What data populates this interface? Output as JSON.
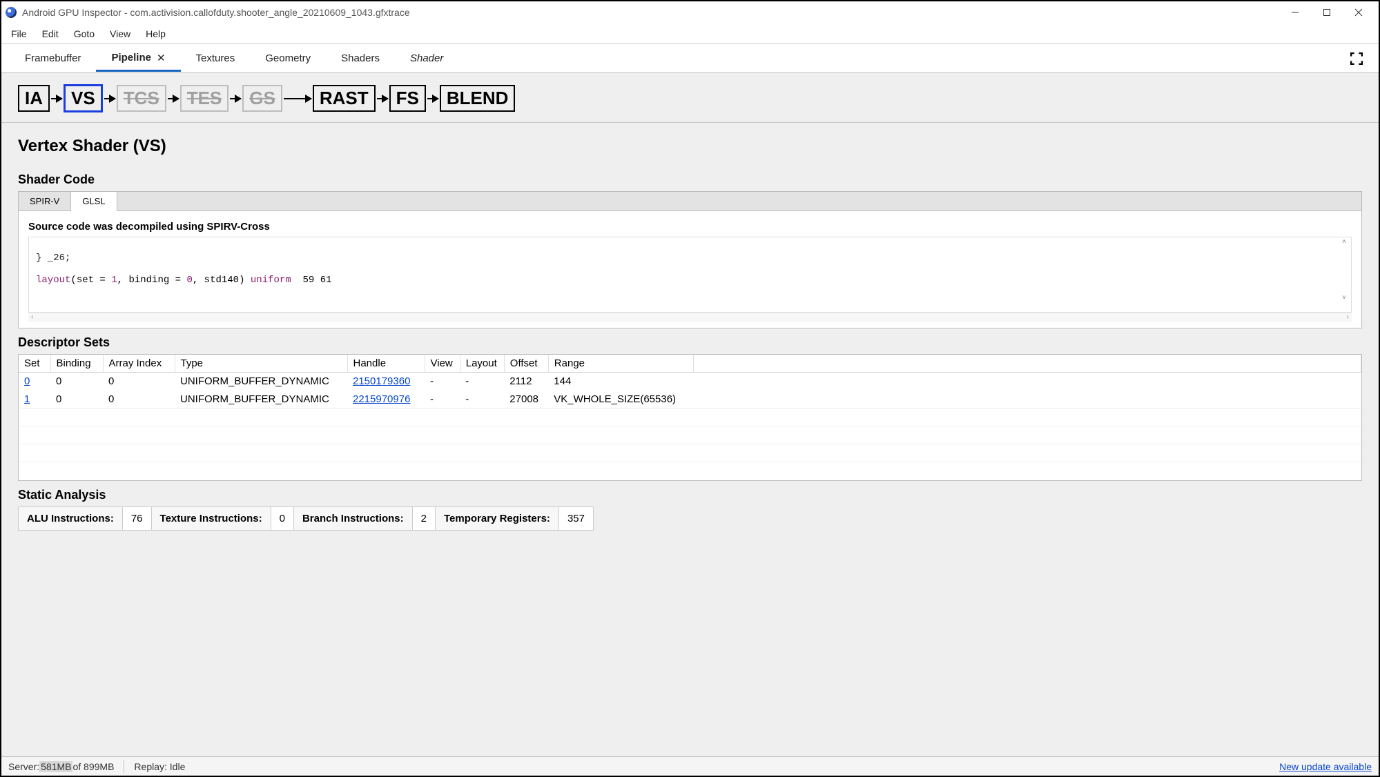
{
  "titlebar": {
    "title": "Android GPU Inspector - com.activision.callofduty.shooter_angle_20210609_1043.gfxtrace"
  },
  "menubar": {
    "items": [
      "File",
      "Edit",
      "Goto",
      "View",
      "Help"
    ]
  },
  "tabs": {
    "items": [
      {
        "label": "Framebuffer",
        "active": false
      },
      {
        "label": "Pipeline",
        "active": true,
        "closable": true
      },
      {
        "label": "Textures",
        "active": false
      },
      {
        "label": "Geometry",
        "active": false
      },
      {
        "label": "Shaders",
        "active": false
      },
      {
        "label": "Shader",
        "active": false,
        "italic": true
      }
    ]
  },
  "pipeline": {
    "stages": [
      {
        "label": "IA",
        "state": "normal"
      },
      {
        "label": "VS",
        "state": "selected"
      },
      {
        "label": "TCS",
        "state": "disabled"
      },
      {
        "label": "TES",
        "state": "disabled"
      },
      {
        "label": "GS",
        "state": "disabled"
      },
      {
        "label": "RAST",
        "state": "normal"
      },
      {
        "label": "FS",
        "state": "normal"
      },
      {
        "label": "BLEND",
        "state": "normal"
      }
    ]
  },
  "section": {
    "title": "Vertex Shader (VS)",
    "shader_code_title": "Shader Code",
    "descriptor_sets_title": "Descriptor Sets",
    "static_analysis_title": "Static Analysis"
  },
  "code_tabs": {
    "items": [
      "SPIR-V",
      "GLSL"
    ],
    "active": "GLSL"
  },
  "code": {
    "note": "Source code was decompiled using SPIRV-Cross",
    "line1": "} _26;",
    "line2_pre": "layout",
    "line2_mid": "(set = ",
    "line2_n1": "1",
    "line2_mid2": ", binding = ",
    "line2_n2": "0",
    "line2_mid3": ", std140) ",
    "line2_kw": "uniform",
    "line2_tail": "  59 61"
  },
  "descriptor_table": {
    "headers": [
      "Set",
      "Binding",
      "Array Index",
      "Type",
      "Handle",
      "View",
      "Layout",
      "Offset",
      "Range"
    ],
    "rows": [
      {
        "set": "0",
        "binding": "0",
        "array_index": "0",
        "type": "UNIFORM_BUFFER_DYNAMIC",
        "handle": "2150179360",
        "view": "-",
        "layout": "-",
        "offset": "2112",
        "range": "144"
      },
      {
        "set": "1",
        "binding": "0",
        "array_index": "0",
        "type": "UNIFORM_BUFFER_DYNAMIC",
        "handle": "2215970976",
        "view": "-",
        "layout": "-",
        "offset": "27008",
        "range": "VK_WHOLE_SIZE(65536)"
      }
    ]
  },
  "static_analysis": {
    "items": [
      {
        "label": "ALU Instructions:",
        "value": "76"
      },
      {
        "label": "Texture Instructions:",
        "value": "0"
      },
      {
        "label": "Branch Instructions:",
        "value": "2"
      },
      {
        "label": "Temporary Registers:",
        "value": "357"
      }
    ]
  },
  "statusbar": {
    "server_label": "Server: ",
    "mem_used": "581MB",
    "mem_total": " of 899MB",
    "replay": "Replay:  Idle",
    "update_link": "New update available"
  }
}
